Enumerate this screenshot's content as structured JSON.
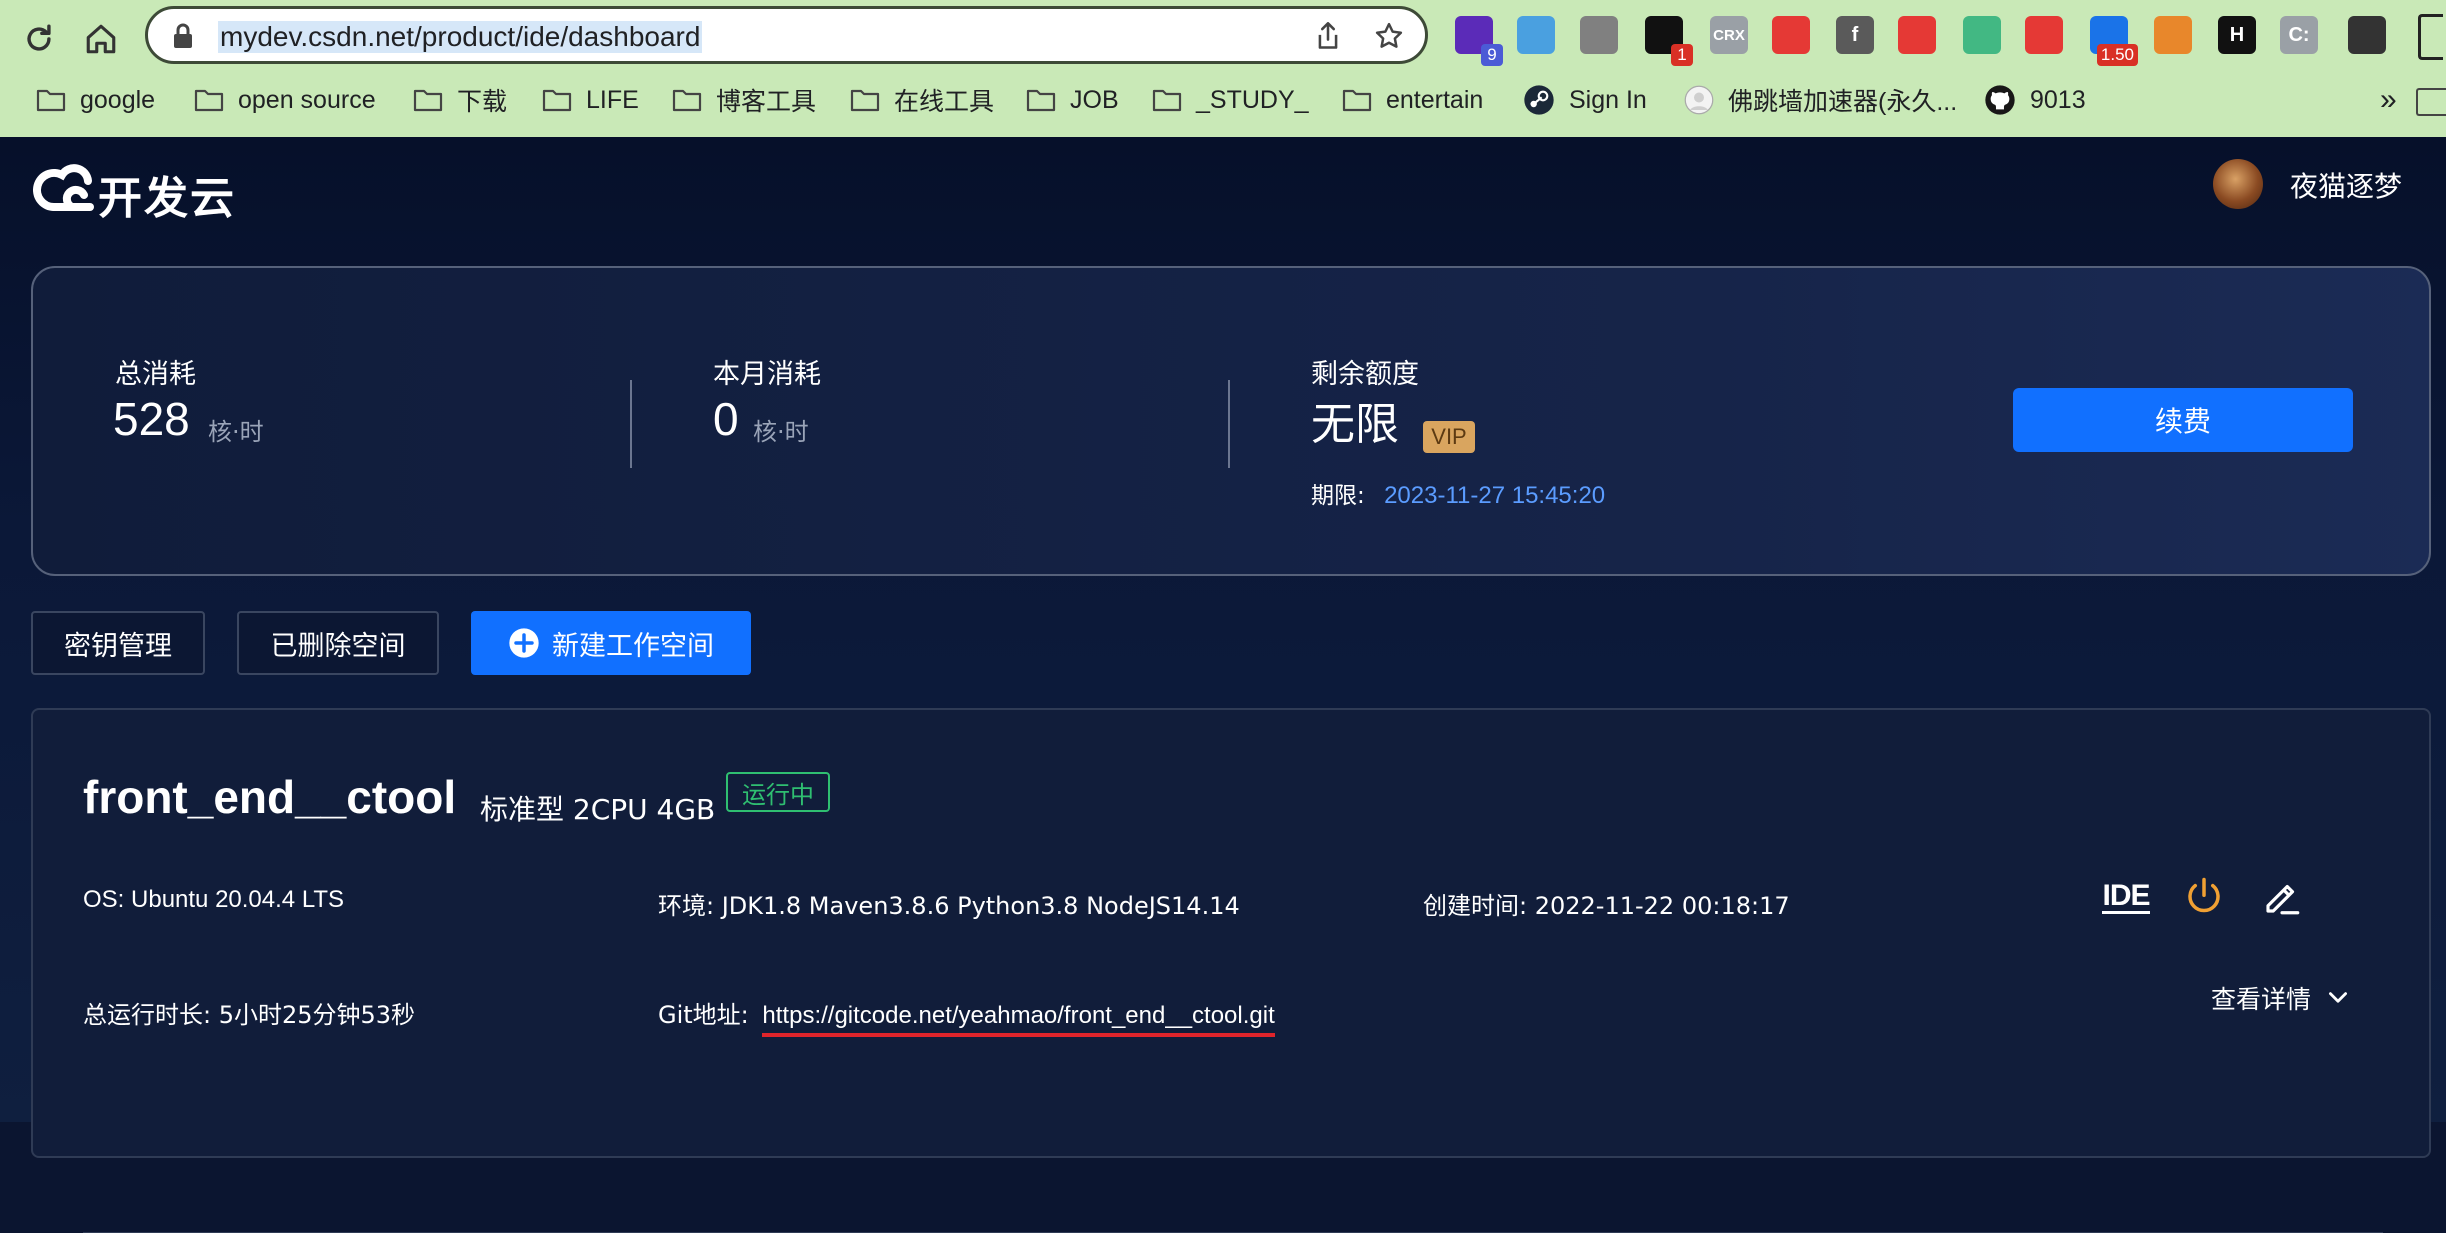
{
  "browser": {
    "url": "mydev.csdn.net/product/ide/dashboard",
    "extensions": [
      {
        "name": "stack-extension",
        "label": "",
        "badge": "9",
        "color": "#5b2bb8",
        "badge_color": "#4b5bd6"
      },
      {
        "name": "wave-extension",
        "label": "",
        "badge": "",
        "color": "#4aa0e0",
        "badge_color": ""
      },
      {
        "name": "mouse-extension",
        "label": "",
        "badge": "",
        "color": "#808080",
        "badge_color": ""
      },
      {
        "name": "notion-extension",
        "label": "",
        "badge": "1",
        "color": "#111111",
        "badge_color": "#d93025"
      },
      {
        "name": "crx-extension",
        "label": "CRX",
        "badge": "",
        "color": "#9aa0a6",
        "badge_color": ""
      },
      {
        "name": "binoculars-extension",
        "label": "",
        "badge": "",
        "color": "#e53935",
        "badge_color": ""
      },
      {
        "name": "f-extension",
        "label": "f",
        "badge": "",
        "color": "#5a5a5a",
        "badge_color": ""
      },
      {
        "name": "tomato-extension",
        "label": "",
        "badge": "",
        "color": "#e53935",
        "badge_color": ""
      },
      {
        "name": "vue-extension",
        "label": "",
        "badge": "",
        "color": "#42b883",
        "badge_color": ""
      },
      {
        "name": "megaphone-extension",
        "label": "",
        "badge": "",
        "color": "#e53935",
        "badge_color": ""
      },
      {
        "name": "speed-extension",
        "label": "",
        "badge": "1.50",
        "color": "#1a73e8",
        "badge_color": "#d93025"
      },
      {
        "name": "kettle-extension",
        "label": "",
        "badge": "",
        "color": "#e8872b",
        "badge_color": ""
      },
      {
        "name": "h-extension",
        "label": "H",
        "badge": "",
        "color": "#111111",
        "badge_color": ""
      },
      {
        "name": "c-extension",
        "label": "C:",
        "badge": "",
        "color": "#9aa0a6",
        "badge_color": ""
      },
      {
        "name": "puzzle-extension",
        "label": "",
        "badge": "",
        "color": "#333333",
        "badge_color": ""
      }
    ],
    "bookmarks": [
      {
        "label": "google",
        "type": "folder"
      },
      {
        "label": "open source",
        "type": "folder"
      },
      {
        "label": "下载",
        "type": "folder"
      },
      {
        "label": "LIFE",
        "type": "folder"
      },
      {
        "label": "博客工具",
        "type": "folder"
      },
      {
        "label": "在线工具",
        "type": "folder"
      },
      {
        "label": "JOB",
        "type": "folder"
      },
      {
        "label": "_STUDY_",
        "type": "folder"
      },
      {
        "label": "entertain",
        "type": "folder"
      },
      {
        "label": "Sign In",
        "type": "steam"
      },
      {
        "label": "佛跳墙加速器(永久...",
        "type": "site"
      },
      {
        "label": "9013",
        "type": "github"
      }
    ],
    "more_bookmarks": "»"
  },
  "header": {
    "logo_text": "开发云",
    "username": "夜猫逐梦"
  },
  "stats": {
    "total_label": "总消耗",
    "total_value": "528",
    "total_unit": "核·时",
    "month_label": "本月消耗",
    "month_value": "0",
    "month_unit": "核·时",
    "remain_label": "剩余额度",
    "remain_value": "无限",
    "vip_badge": "VIP",
    "expiry_label": "期限:",
    "expiry_value": "2023-11-27 15:45:20",
    "renew_label": "续费"
  },
  "toolbar": {
    "keys_label": "密钥管理",
    "deleted_label": "已删除空间",
    "new_label": "新建工作空间"
  },
  "workspace": {
    "name": "front_end__ctool",
    "spec": "标准型 2CPU 4GB",
    "status": "运行中",
    "os": "OS: Ubuntu 20.04.4 LTS",
    "env": "环境: JDK1.8 Maven3.8.6 Python3.8 NodeJS14.14",
    "created": "创建时间: 2022-11-22 00:18:17",
    "runtime": "总运行时长: 5小时25分钟53秒",
    "git_label": "Git地址:",
    "git_url": "https://gitcode.net/yeahmao/front_end__ctool.git",
    "ide_label": "IDE",
    "detail_label": "查看详情"
  },
  "colors": {
    "accent": "#1170ff",
    "status_green": "#2fbf71",
    "vip_gold": "#d9a55f",
    "expiry_blue": "#5b9cff",
    "power_orange": "#f0a033",
    "highlight_red": "#e0242b"
  }
}
